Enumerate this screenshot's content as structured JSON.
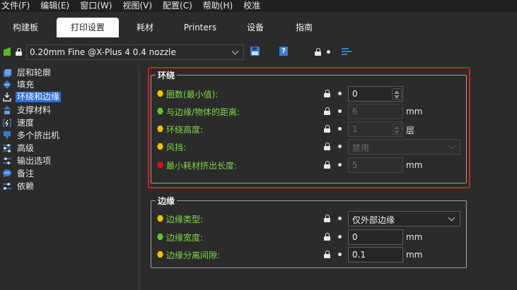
{
  "menu": [
    "文件(F)",
    "编辑(E)",
    "窗口(W)",
    "视图(V)",
    "配置(C)",
    "帮助(H)",
    "校准"
  ],
  "tabs": [
    "构建板",
    "打印设置",
    "耗材",
    "Printers",
    "设备",
    "指南"
  ],
  "active_tab": "打印设置",
  "preset": {
    "name": "0.20mm Fine @X-Plus 4 0.4 nozzle",
    "flag_color": "#5cb82a"
  },
  "sidebar": {
    "items": [
      {
        "label": "层和轮廓",
        "icon": "layers-icon"
      },
      {
        "label": "填充",
        "icon": "infill-icon"
      },
      {
        "label": "环绕和边缘",
        "icon": "skirt-brim-icon"
      },
      {
        "label": "支撑材料",
        "icon": "support-icon"
      },
      {
        "label": "速度",
        "icon": "speed-icon"
      },
      {
        "label": "多个挤出机",
        "icon": "extruder-icon"
      },
      {
        "label": "高级",
        "icon": "advanced-icon"
      },
      {
        "label": "输出选项",
        "icon": "output-icon"
      },
      {
        "label": "备注",
        "icon": "notes-icon"
      },
      {
        "label": "依赖",
        "icon": "dependencies-icon"
      }
    ],
    "active_index": 2
  },
  "skirt": {
    "title": "环绕",
    "rows": [
      {
        "label": "圈数(最小值):",
        "value": "0",
        "unit": "",
        "dot": "#f0c000",
        "kind": "spin",
        "disabled": false
      },
      {
        "label": "与边缘/物体的距离:",
        "value": "6",
        "unit": "mm",
        "dot": "#5cc42a",
        "kind": "text",
        "disabled": true
      },
      {
        "label": "环绕高度:",
        "value": "1",
        "unit": "层",
        "dot": "#f0c000",
        "kind": "spin",
        "disabled": true
      },
      {
        "label": "风挡:",
        "value": "禁用",
        "unit": "",
        "dot": "#f0c000",
        "kind": "select",
        "disabled": true
      },
      {
        "label": "最小耗材挤出长度:",
        "value": "5",
        "unit": "mm",
        "dot": "#e01010",
        "kind": "text",
        "disabled": true
      }
    ]
  },
  "brim": {
    "title": "边缘",
    "rows": [
      {
        "label": "边缘类型:",
        "value": "仅外部边缘",
        "unit": "",
        "dot": "#f0c000",
        "kind": "select",
        "disabled": false
      },
      {
        "label": "边缘宽度:",
        "value": "0",
        "unit": "mm",
        "dot": "#5cc42a",
        "kind": "text",
        "disabled": false
      },
      {
        "label": "边缘分离间隙:",
        "value": "0.1",
        "unit": "mm",
        "dot": "#f0c000",
        "kind": "text",
        "disabled": false
      }
    ]
  },
  "colors": {
    "accent": "#2f6ecf",
    "label_green": "#7fd44a",
    "highlight_red": "#d42020"
  }
}
